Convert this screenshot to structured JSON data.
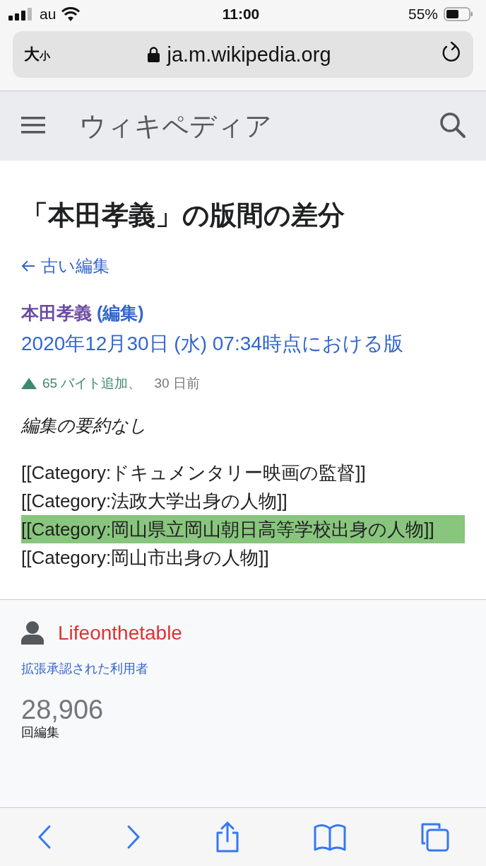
{
  "status_bar": {
    "carrier": "au",
    "time": "11:00",
    "battery": "55%"
  },
  "address_bar": {
    "text_size_large": "大",
    "text_size_small": "小",
    "url": "ja.m.wikipedia.org"
  },
  "header": {
    "logo": "ウィキペディア"
  },
  "page": {
    "title": "「本田孝義」の版間の差分",
    "back_link": "古い編集",
    "revision": {
      "page_link": "本田孝義",
      "edit_link": "(編集)",
      "timestamp": "2020年12月30日 (水) 07:34時点における版"
    },
    "change": {
      "bytes": "65 バイト追加、",
      "age": "30 日前"
    },
    "summary": "編集の要約なし",
    "diff_lines": [
      {
        "kind": "context",
        "text": "[[Category:ドキュメンタリー映画の監督]]"
      },
      {
        "kind": "context",
        "text": "[[Category:法政大学出身の人物]]"
      },
      {
        "kind": "added",
        "text": "[[Category:岡山県立岡山朝日高等学校出身の人物]]"
      },
      {
        "kind": "context",
        "text": "[[Category:岡山市出身の人物]]"
      }
    ]
  },
  "user": {
    "name": "Lifeonthetable",
    "group": "拡張承認された利用者",
    "edit_count": "28,906",
    "edit_count_label": "回編集"
  }
}
